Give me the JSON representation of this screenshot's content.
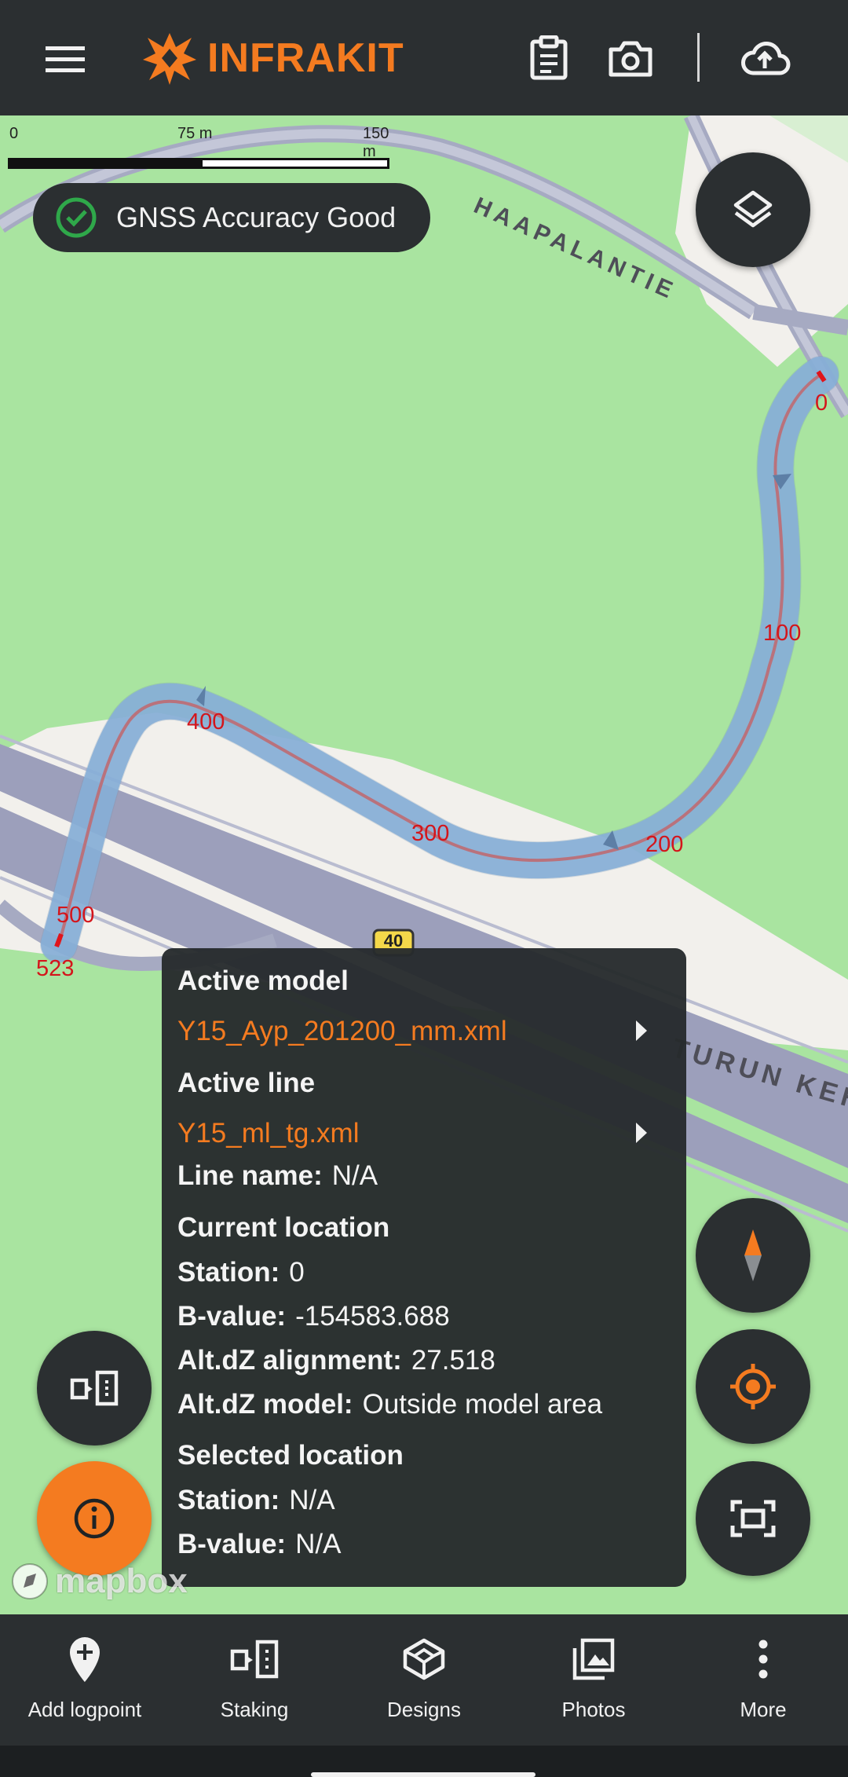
{
  "header": {
    "app_name": "INFRAKIT",
    "brand_color": "#f47b20",
    "icons": [
      "menu-icon",
      "clipboard-icon",
      "camera-icon",
      "cloud-upload-icon"
    ]
  },
  "map": {
    "scale": {
      "labels": [
        "0",
        "75 m",
        "150 m"
      ]
    },
    "gnss": {
      "text": "GNSS Accuracy Good",
      "status_color": "#2fa84a"
    },
    "roads": {
      "haapalantie": "HAAPALANTIE",
      "turun": "TURUN KEH",
      "shield": "40"
    },
    "stations": [
      "0",
      "100",
      "200",
      "300",
      "400",
      "500",
      "523"
    ],
    "attribution": "mapbox"
  },
  "info_panel": {
    "active_model_heading": "Active model",
    "active_model_value": "Y15_Ayp_201200_mm.xml",
    "active_line_heading": "Active line",
    "active_line_value": "Y15_ml_tg.xml",
    "line_name_label": "Line name:",
    "line_name_value": "N/A",
    "current_location_heading": "Current location",
    "station_label": "Station:",
    "station_value": "0",
    "bvalue_label": "B-value:",
    "bvalue_value": "-154583.688",
    "altdz_alignment_label": "Alt.dZ alignment:",
    "altdz_alignment_value": "27.518",
    "altdz_model_label": "Alt.dZ model:",
    "altdz_model_value": "Outside model area",
    "selected_location_heading": "Selected location",
    "sel_station_label": "Station:",
    "sel_station_value": "N/A",
    "sel_bvalue_label": "B-value:",
    "sel_bvalue_value": "N/A"
  },
  "bottom_nav": {
    "items": [
      {
        "label": "Add logpoint",
        "icon": "add-logpoint-icon"
      },
      {
        "label": "Staking",
        "icon": "staking-icon"
      },
      {
        "label": "Designs",
        "icon": "designs-icon"
      },
      {
        "label": "Photos",
        "icon": "photos-icon"
      },
      {
        "label": "More",
        "icon": "more-icon"
      }
    ]
  }
}
